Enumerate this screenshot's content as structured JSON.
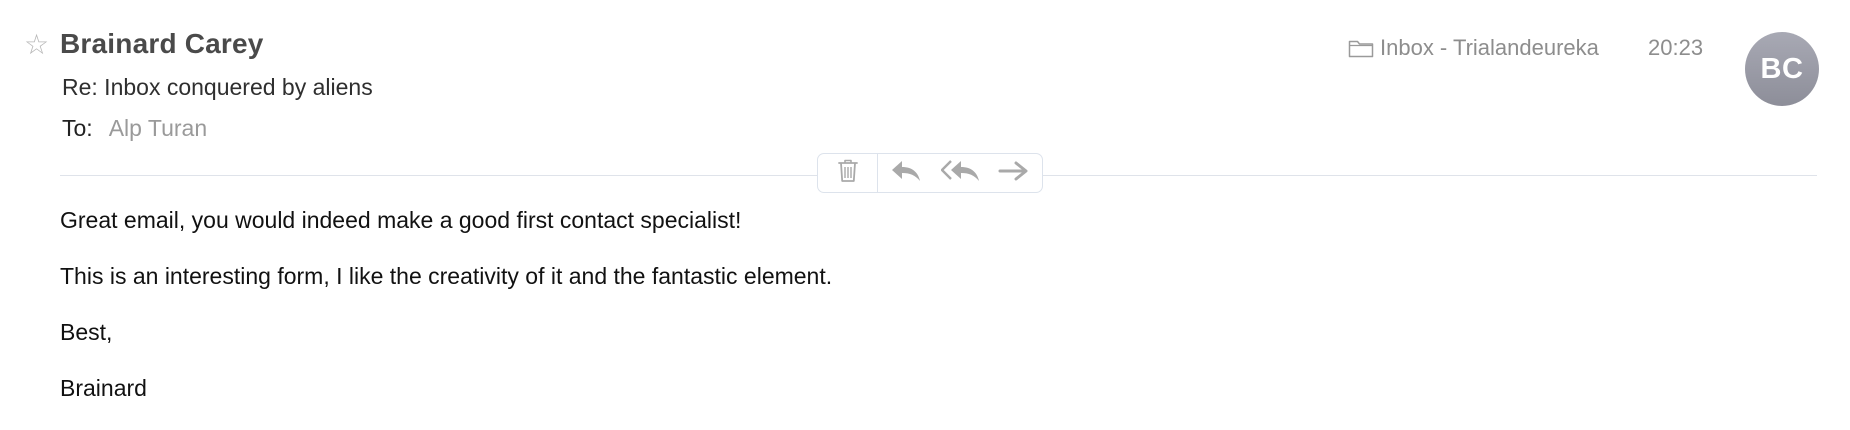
{
  "header": {
    "sender": "Brainard Carey",
    "subject": "Re: Inbox conquered by aliens",
    "to_label": "To:",
    "recipient": "Alp Turan",
    "mailbox": "Inbox - Trialandeureka",
    "time": "20:23",
    "avatar_initials": "BC",
    "star_icon": "star-outline-icon",
    "mailbox_icon": "folder-icon"
  },
  "toolbar": {
    "icons": [
      "trash-icon",
      "reply-icon",
      "reply-all-icon",
      "forward-icon"
    ]
  },
  "body": {
    "lines": [
      "Great email, you would indeed make a good first contact specialist!",
      "This is an interesting form, I like the creativity of it and the fantastic element.",
      "Best,",
      "Brainard"
    ]
  },
  "colors": {
    "sender": "#4a4a4a",
    "meta": "#8d8d8d",
    "recipient": "#9a9a9a",
    "avatar": "#9899a4",
    "divider": "#dfe3ea",
    "icon": "#a9a9a9"
  }
}
